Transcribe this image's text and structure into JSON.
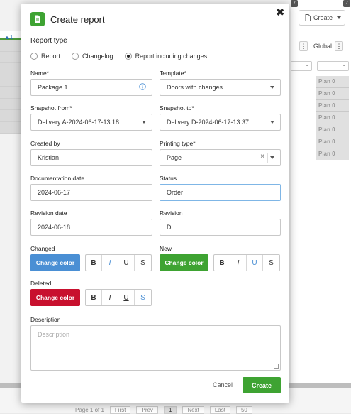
{
  "background": {
    "sort_indicator": "▲1",
    "create_button": "Create",
    "badge_left": "7",
    "badge_right": "7",
    "column_header": "Global",
    "plan_values": [
      "Plan 0",
      "Plan 0",
      "Plan 0",
      "Plan 0",
      "Plan 0",
      "Plan 0",
      "Plan 0"
    ],
    "pager": {
      "page_info": "Page 1 of 1",
      "first": "First",
      "prev": "Prev",
      "current": "1",
      "next": "Next",
      "last": "Last",
      "page_size": "50"
    }
  },
  "modal": {
    "title": "Create report",
    "close": "✖",
    "report_type": {
      "label": "Report type",
      "options": [
        "Report",
        "Changelog",
        "Report including changes"
      ],
      "selected": "Report including changes"
    },
    "name": {
      "label": "Name*",
      "value": "Package 1"
    },
    "template": {
      "label": "Template*",
      "value": "Doors with changes"
    },
    "snapshot_from": {
      "label": "Snapshot from*",
      "value": "Delivery A-2024-06-17-13:18"
    },
    "snapshot_to": {
      "label": "Snapshot to*",
      "value": "Delivery D-2024-06-17-13:37"
    },
    "created_by": {
      "label": "Created by",
      "value": "Kristian"
    },
    "printing_type": {
      "label": "Printing type*",
      "value": "Page"
    },
    "documentation_date": {
      "label": "Documentation date",
      "value": "2024-06-17"
    },
    "status": {
      "label": "Status",
      "value": "Order"
    },
    "revision_date": {
      "label": "Revision date",
      "value": "2024-06-18"
    },
    "revision": {
      "label": "Revision",
      "value": "D"
    },
    "changed": {
      "label": "Changed",
      "button": "Change color",
      "color": "#4a8fd4"
    },
    "new": {
      "label": "New",
      "button": "Change color",
      "color": "#3ea332"
    },
    "deleted": {
      "label": "Deleted",
      "button": "Change color",
      "color": "#c8102e"
    },
    "format_buttons": {
      "bold": "B",
      "italic": "I",
      "underline": "U",
      "strike": "S"
    },
    "description": {
      "label": "Description",
      "placeholder": "Description"
    },
    "cancel": "Cancel",
    "create": "Create"
  }
}
